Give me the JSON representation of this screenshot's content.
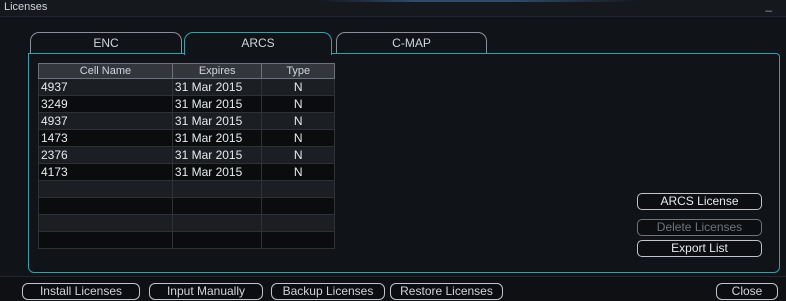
{
  "window": {
    "title": "Licenses"
  },
  "tabs": [
    {
      "label": "ENC"
    },
    {
      "label": "ARCS"
    },
    {
      "label": "C-MAP"
    }
  ],
  "table": {
    "columns": [
      "Cell Name",
      "Expires",
      "Type"
    ],
    "rows": [
      {
        "name": "4937",
        "expires": "31 Mar 2015",
        "type": "N"
      },
      {
        "name": "3249",
        "expires": "31 Mar 2015",
        "type": "N"
      },
      {
        "name": "4937",
        "expires": "31 Mar 2015",
        "type": "N"
      },
      {
        "name": "1473",
        "expires": "31 Mar 2015",
        "type": "N"
      },
      {
        "name": "2376",
        "expires": "31 Mar 2015",
        "type": "N"
      },
      {
        "name": "4173",
        "expires": "31 Mar 2015",
        "type": "N"
      },
      {
        "name": "",
        "expires": "",
        "type": ""
      },
      {
        "name": "",
        "expires": "",
        "type": ""
      },
      {
        "name": "",
        "expires": "",
        "type": ""
      },
      {
        "name": "",
        "expires": "",
        "type": ""
      }
    ]
  },
  "side_buttons": {
    "arcs_license": "ARCS License",
    "delete_licenses": "Delete Licenses",
    "export_list": "Export List"
  },
  "bottom_buttons": {
    "install": "Install Licenses",
    "input_manually": "Input Manually",
    "backup": "Backup Licenses",
    "restore": "Restore Licenses",
    "close": "Close"
  },
  "titlebar_icons": {
    "minimize": "_",
    "close": "×"
  }
}
